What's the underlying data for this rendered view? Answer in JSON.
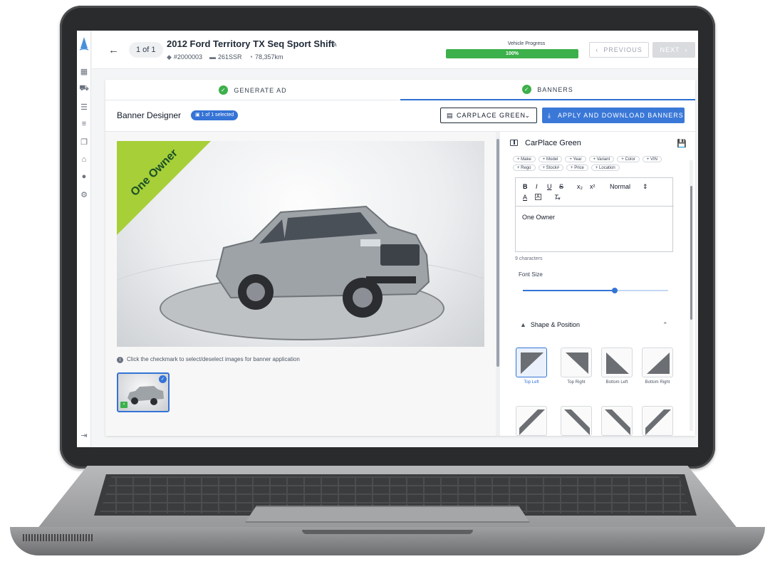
{
  "header": {
    "pager": "1 of 1",
    "vehicle_title": "2012 Ford Territory TX Seq Sport Shift",
    "stock": "#2000003",
    "rego": "261SSR",
    "odometer": "78,357km",
    "progress_label": "Vehicle Progress",
    "progress_value": 100,
    "progress_text": "100%",
    "prev_label": "PREVIOUS",
    "next_label": "NEXT"
  },
  "steps": [
    {
      "label": "GENERATE AD",
      "done": true
    },
    {
      "label": "BANNERS",
      "done": true,
      "active": true
    }
  ],
  "designer": {
    "title": "Banner Designer",
    "selected_badge": "1 of 1 selected",
    "preset_label": "CARPLACE GREEN",
    "apply_label": "APPLY AND DOWNLOAD BANNERS",
    "banner_text": "One Owner",
    "banner_color": "#a6cf38",
    "caption": "Click the checkmark to select/deselect images for banner application"
  },
  "editor_panel": {
    "title": "CarPlace Green",
    "tokens": [
      "Make",
      "Model",
      "Year",
      "Variant",
      "Color",
      "VIN",
      "Rego",
      "Stock#",
      "Price",
      "Location"
    ],
    "format_select": "Normal",
    "content": "One Owner",
    "char_count": "9 characters",
    "font_size_label": "Font Size",
    "font_size_fraction": 0.63,
    "shape_position_label": "Shape & Position",
    "shapes": [
      {
        "label": "Top Left",
        "selected": true
      },
      {
        "label": "Top Right",
        "selected": false
      },
      {
        "label": "Bottom Left",
        "selected": false
      },
      {
        "label": "Bottom Right",
        "selected": false
      }
    ]
  },
  "colors": {
    "accent": "#3573d6",
    "success": "#3cb04a",
    "banner_green": "#a6cf38"
  }
}
